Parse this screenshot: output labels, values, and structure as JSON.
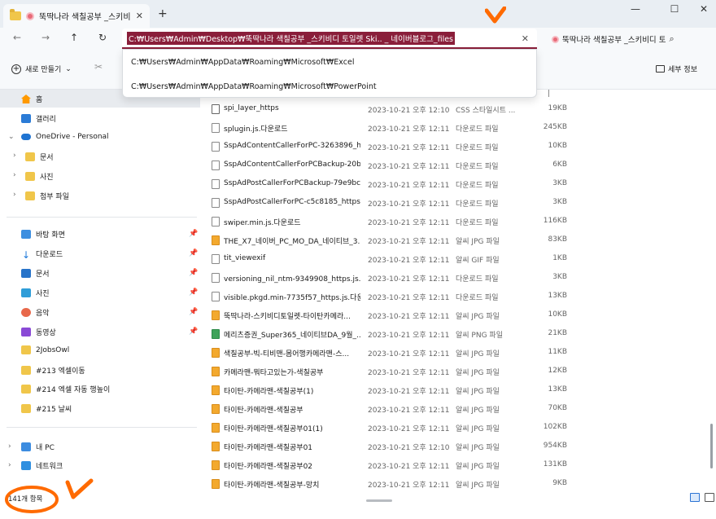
{
  "window": {
    "tab_title": "뚝딱나라 색칠공부 _스키비디",
    "new_tab": "+",
    "tab_close": "✕",
    "minimize": "—",
    "maximize": "☐",
    "close": "✕"
  },
  "address": {
    "path": "C:₩Users₩Admin₩Desktop₩뚝딱나라 색칠공부 _스키비디 토일렛 Ski.. _ 네이버블로그_files",
    "search_text": "뚝딱나라 색칠공부 _스키비디 토",
    "suggestions": [
      "C:₩Users₩Admin₩AppData₩Roaming₩Microsoft₩Excel",
      "C:₩Users₩Admin₩AppData₩Roaming₩Microsoft₩PowerPoint"
    ]
  },
  "toolbar": {
    "new_label": "새로 만들기",
    "details_label": "세부 정보"
  },
  "sidebar": {
    "home": "홈",
    "gallery": "갤러리",
    "onedrive": "OneDrive - Personal",
    "onedrive_items": [
      "문서",
      "사진",
      "첨부 파일"
    ],
    "quick": [
      "바탕 화면",
      "다운로드",
      "문서",
      "사진",
      "음악",
      "동영상",
      "2JobsOwl",
      "#213 엑셀이동",
      "#214 엑셀 자동 행높이",
      "#215 날씨"
    ],
    "this_pc": "내 PC",
    "network": "네트워크"
  },
  "files": [
    {
      "name": "spi_layer_https",
      "date": "2023-10-21 오후 12:10",
      "type": "CSS 스타일시트 ...",
      "size": "19KB",
      "icon": "css"
    },
    {
      "name": "splugin.js.다운로드",
      "date": "2023-10-21 오후 12:11",
      "type": "다운로드 파일",
      "size": "245KB",
      "icon": "file"
    },
    {
      "name": "SspAdContentCallerForPC-3263896_htt...",
      "date": "2023-10-21 오후 12:11",
      "type": "다운로드 파일",
      "size": "10KB",
      "icon": "file"
    },
    {
      "name": "SspAdContentCallerForPCBackup-20b0e...",
      "date": "2023-10-21 오후 12:11",
      "type": "다운로드 파일",
      "size": "6KB",
      "icon": "file"
    },
    {
      "name": "SspAdPostCallerForPCBackup-79e9bc3_...",
      "date": "2023-10-21 오후 12:11",
      "type": "다운로드 파일",
      "size": "3KB",
      "icon": "file"
    },
    {
      "name": "SspAdPostCallerForPC-c5c8185_https.js...",
      "date": "2023-10-21 오후 12:11",
      "type": "다운로드 파일",
      "size": "3KB",
      "icon": "file"
    },
    {
      "name": "swiper.min.js.다운로드",
      "date": "2023-10-21 오후 12:11",
      "type": "다운로드 파일",
      "size": "116KB",
      "icon": "file"
    },
    {
      "name": "THE_X7_네이버_PC_MO_DA_네이티브_3...",
      "date": "2023-10-21 오후 12:11",
      "type": "알씨 JPG 파일",
      "size": "83KB",
      "icon": "img"
    },
    {
      "name": "tit_viewexif",
      "date": "2023-10-21 오후 12:11",
      "type": "알씨 GIF 파일",
      "size": "1KB",
      "icon": "file"
    },
    {
      "name": "versioning_nil_ntm-9349908_https.js.다...",
      "date": "2023-10-21 오후 12:11",
      "type": "다운로드 파일",
      "size": "3KB",
      "icon": "file"
    },
    {
      "name": "visible.pkgd.min-7735f57_https.js.다운...",
      "date": "2023-10-21 오후 12:11",
      "type": "다운로드 파일",
      "size": "13KB",
      "icon": "file"
    },
    {
      "name": "뚝딱나라-스키비디토일렛-타이탄카메라...",
      "date": "2023-10-21 오후 12:11",
      "type": "알씨 JPG 파일",
      "size": "10KB",
      "icon": "img"
    },
    {
      "name": "메리츠증권_Super365_네이티브DA_9월_...",
      "date": "2023-10-21 오후 12:11",
      "type": "알씨 PNG 파일",
      "size": "21KB",
      "icon": "png"
    },
    {
      "name": "색칠공부-빅-티비맨-몸어행카메라맨-스...",
      "date": "2023-10-21 오후 12:11",
      "type": "알씨 JPG 파일",
      "size": "11KB",
      "icon": "img"
    },
    {
      "name": "카메라맨-뭐타고있는가-색칠공부",
      "date": "2023-10-21 오후 12:11",
      "type": "알씨 JPG 파일",
      "size": "12KB",
      "icon": "img"
    },
    {
      "name": "타이탄-카메라맨-색칠공부(1)",
      "date": "2023-10-21 오후 12:11",
      "type": "알씨 JPG 파일",
      "size": "13KB",
      "icon": "img"
    },
    {
      "name": "타이탄-카메라맨-색칠공부",
      "date": "2023-10-21 오후 12:11",
      "type": "알씨 JPG 파일",
      "size": "70KB",
      "icon": "img"
    },
    {
      "name": "타이탄-카메라맨-색칠공부01(1)",
      "date": "2023-10-21 오후 12:11",
      "type": "알씨 JPG 파일",
      "size": "102KB",
      "icon": "img"
    },
    {
      "name": "타이탄-카메라맨-색칠공부01",
      "date": "2023-10-21 오후 12:10",
      "type": "알씨 JPG 파일",
      "size": "954KB",
      "icon": "img"
    },
    {
      "name": "타이탄-카메라맨-색칠공부02",
      "date": "2023-10-21 오후 12:11",
      "type": "알씨 JPG 파일",
      "size": "131KB",
      "icon": "img"
    },
    {
      "name": "타이탄-카메라맨-색칠공부-망치",
      "date": "2023-10-21 오후 12:11",
      "type": "알씨 JPG 파일",
      "size": "9KB",
      "icon": "img"
    }
  ],
  "status": {
    "count": "141개 항목"
  },
  "colors": {
    "accent": "#8a1e3a",
    "annotation": "#ff6a00"
  }
}
